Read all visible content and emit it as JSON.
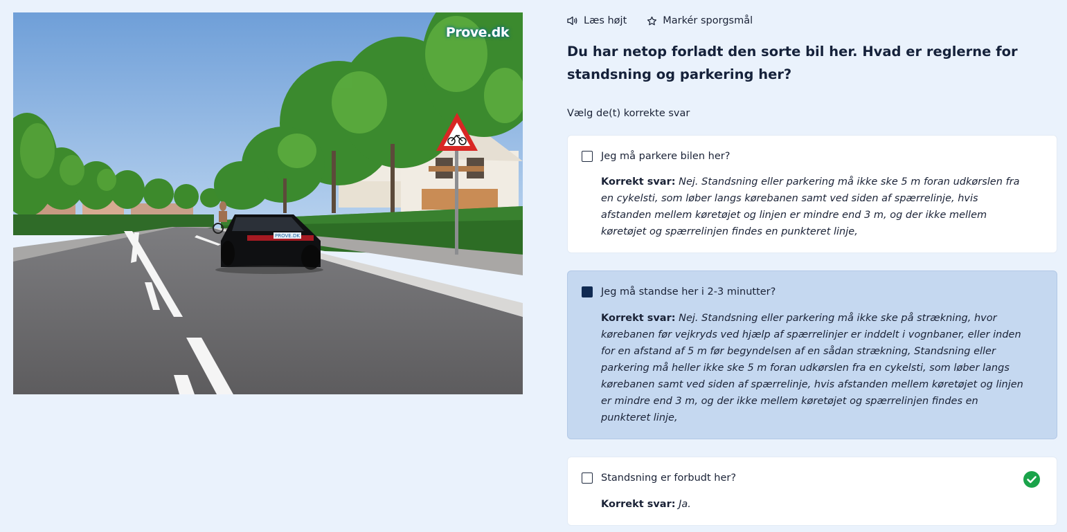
{
  "toolbar": {
    "read_aloud": "Læs højt",
    "mark_question": "Markér sporgsmål"
  },
  "image": {
    "logo": "Prove.dk",
    "plate": "PROVE.DK"
  },
  "question": "Du har netop forladt den sorte bil her. Hvad er reglerne for standsning og parkering her?",
  "instruction": "Vælg de(t) korrekte svar",
  "options": [
    {
      "label": "Jeg må parkere bilen her?",
      "answer_label": "Korrekt svar:",
      "answer_text": "Nej. Standsning eller parkering må ikke ske 5 m foran udkørslen fra en cykelsti, som løber langs kørebanen samt ved siden af spærrelinje, hvis afstanden mellem køretøjet og linjen er mindre end 3 m, og der ikke mellem køretøjet og spærrelinjen findes en punkteret linje,",
      "checked": false,
      "correct_icon": false
    },
    {
      "label": "Jeg må standse her i 2-3 minutter?",
      "answer_label": "Korrekt svar:",
      "answer_text": "Nej. Standsning eller parkering må ikke ske på strækning, hvor kørebanen før vejkryds ved hjælp af spærrelinjer er inddelt i vognbaner, eller inden for en afstand af 5 m før begyndelsen af en sådan strækning, Standsning eller parkering må heller ikke ske 5 m foran udkørslen fra en cykelsti, som løber langs kørebanen samt ved siden af spærrelinje, hvis afstanden mellem køretøjet og linjen er mindre end 3 m, og der ikke mellem køretøjet og spærrelinjen findes en punkteret linje,",
      "checked": true,
      "correct_icon": false
    },
    {
      "label": "Standsning er forbudt her?",
      "answer_label": "Korrekt svar:",
      "answer_text": "Ja.",
      "checked": false,
      "correct_icon": true
    }
  ],
  "colors": {
    "page_bg": "#eaf2fc",
    "card_bg": "#ffffff",
    "selected_card_bg": "#c5d8f0",
    "checkbox_checked": "#102a52",
    "correct_green": "#1aa34a"
  }
}
